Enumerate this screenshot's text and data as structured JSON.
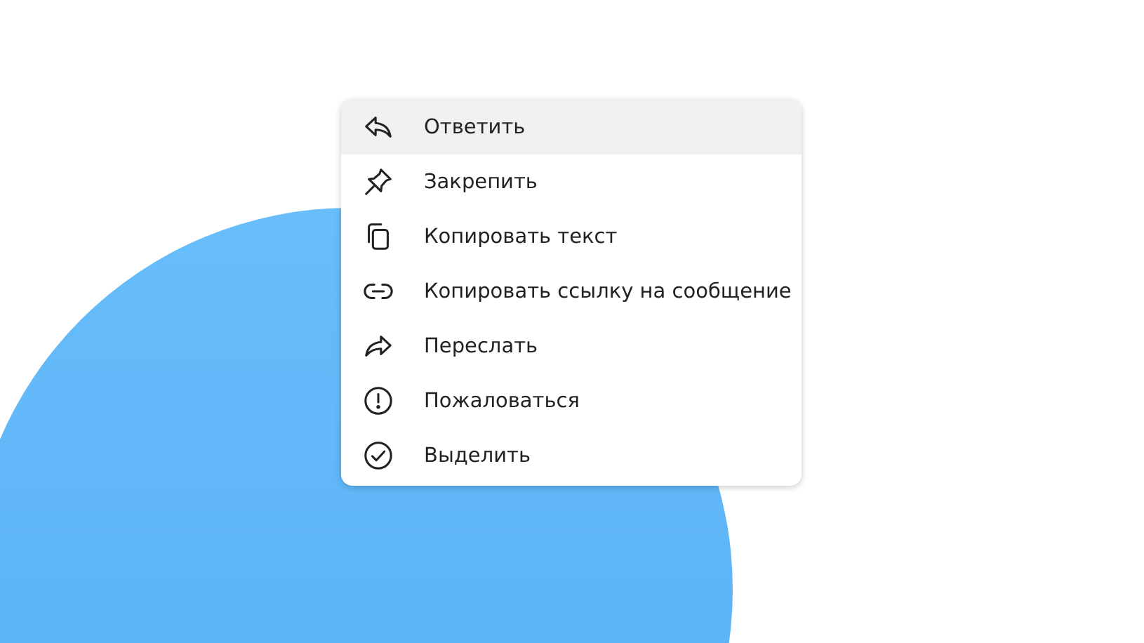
{
  "context_menu": {
    "items": [
      {
        "kind": "reply",
        "label": "Ответить",
        "selected": true
      },
      {
        "kind": "pin",
        "label": "Закрепить",
        "selected": false
      },
      {
        "kind": "copy",
        "label": "Копировать текст",
        "selected": false
      },
      {
        "kind": "link",
        "label": "Копировать ссылку на сообщение",
        "selected": false
      },
      {
        "kind": "forward",
        "label": "Переслать",
        "selected": false
      },
      {
        "kind": "report",
        "label": "Пожаловаться",
        "selected": false
      },
      {
        "kind": "select",
        "label": "Выделить",
        "selected": false
      }
    ]
  }
}
